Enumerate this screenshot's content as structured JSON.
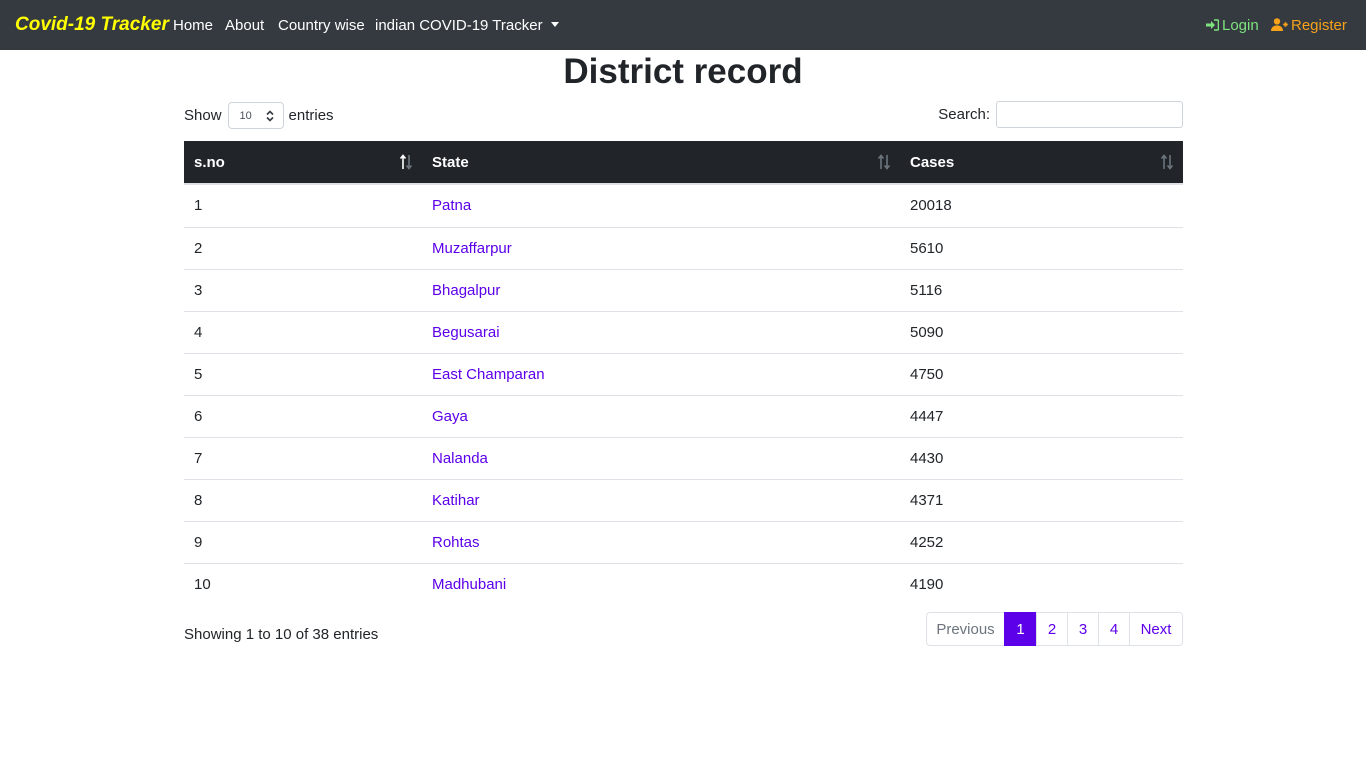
{
  "navbar": {
    "brand": "Covid-19 Tracker",
    "links": [
      "Home",
      "About",
      "Country wise",
      "indian COVID-19 Tracker"
    ],
    "login": "Login",
    "register": "Register",
    "colors": {
      "brand": "#ffff00",
      "login": "#7ee27e",
      "register": "#f7a21a",
      "background": "#343a40"
    }
  },
  "title": "District record",
  "length": {
    "show_label": "Show",
    "value": "10",
    "entries_label": "entries"
  },
  "search": {
    "label": "Search:",
    "value": ""
  },
  "table": {
    "columns": [
      "s.no",
      "State",
      "Cases"
    ],
    "rows": [
      {
        "sno": "1",
        "state": "Patna",
        "cases": "20018"
      },
      {
        "sno": "2",
        "state": "Muzaffarpur",
        "cases": "5610"
      },
      {
        "sno": "3",
        "state": "Bhagalpur",
        "cases": "5116"
      },
      {
        "sno": "4",
        "state": "Begusarai",
        "cases": "5090"
      },
      {
        "sno": "5",
        "state": "East Champaran",
        "cases": "4750"
      },
      {
        "sno": "6",
        "state": "Gaya",
        "cases": "4447"
      },
      {
        "sno": "7",
        "state": "Nalanda",
        "cases": "4430"
      },
      {
        "sno": "8",
        "state": "Katihar",
        "cases": "4371"
      },
      {
        "sno": "9",
        "state": "Rohtas",
        "cases": "4252"
      },
      {
        "sno": "10",
        "state": "Madhubani",
        "cases": "4190"
      }
    ]
  },
  "info": "Showing 1 to 10 of 38 entries",
  "pagination": {
    "previous": "Previous",
    "pages": [
      "1",
      "2",
      "3",
      "4"
    ],
    "active": "1",
    "next": "Next",
    "accent": "#5c00ea"
  }
}
